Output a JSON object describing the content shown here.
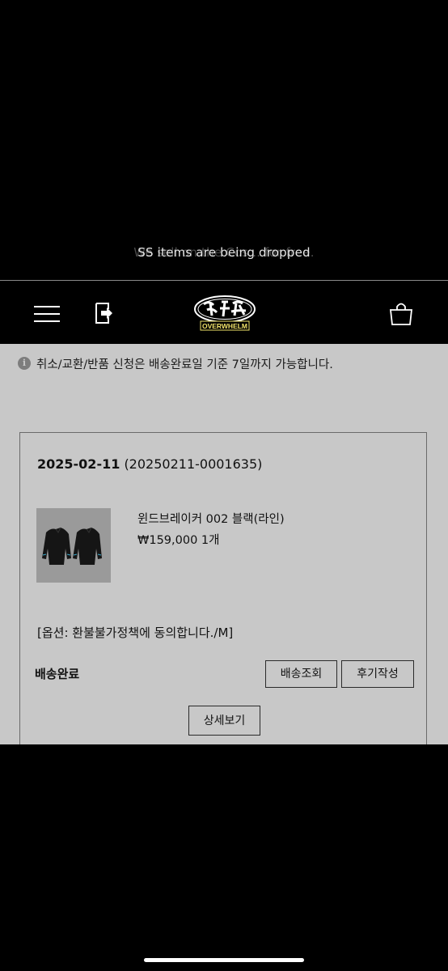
{
  "banner": {
    "text": "SS items are being dropped",
    "ghost_text": "We sell on the Cos... for free.",
    "colors": {
      "text": "#e8e8e8",
      "ghost": "#4a4a4a"
    }
  },
  "header": {
    "logo_text": "OVERWHELM",
    "icons": [
      "hamburger-menu-icon",
      "login-icon",
      "logo",
      "shopping-bag-icon"
    ]
  },
  "notice": {
    "icon": "info-icon",
    "text": "취소/교환/반품 신청은 배송완료일 기준 7일까지 가능합니다."
  },
  "order": {
    "date": "2025-02-11",
    "number": "(20250211-0001635)",
    "product_name": "윈드브레이커 002 블랙(라인)",
    "price": "₩159,000",
    "quantity": "1개",
    "option": "[옵션: 환불불가정책에 동의합니다./M]",
    "status": "배송완료",
    "buttons": {
      "track": "배송조회",
      "review": "후기작성",
      "detail": "상세보기"
    }
  },
  "colors": {
    "background": "#000000",
    "content_bg": "#c8c8c8",
    "text": "#111111"
  }
}
